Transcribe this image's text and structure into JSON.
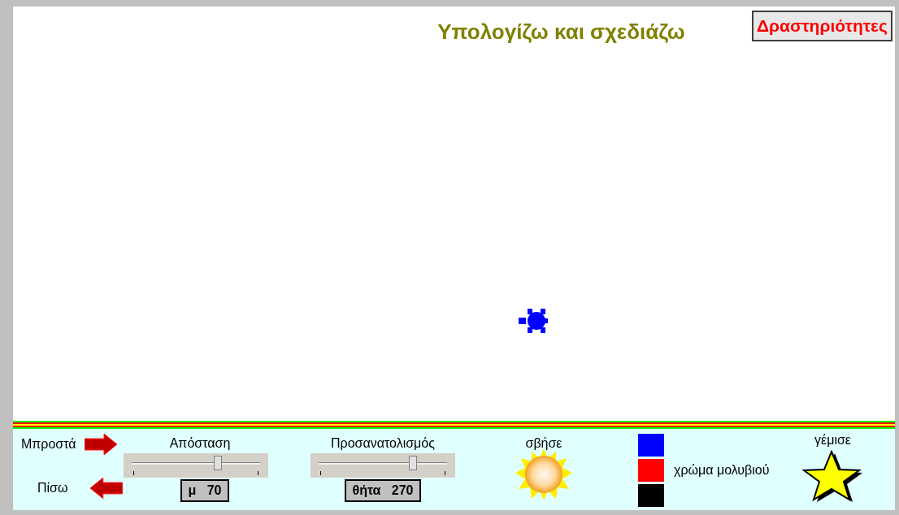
{
  "title": "Υπολογίζω και σχεδιάζω",
  "activities_button": "Δραστηριότητες",
  "forward": {
    "label": "Μπροστά"
  },
  "back": {
    "label": "Πίσω"
  },
  "distance": {
    "label": "Απόσταση",
    "level": 0.68,
    "reading": "μ   70"
  },
  "heading": {
    "label": "Προσανατολισμός",
    "level": 0.75,
    "reading": "θήτα   270"
  },
  "erase": {
    "label": "σβήσε"
  },
  "pen_colors": {
    "label": "χρώμα μολυβιού",
    "swatches": [
      {
        "color": "#0000ff"
      },
      {
        "color": "#ff0000"
      },
      {
        "color": "#000000"
      }
    ]
  },
  "fill": {
    "label": "γέμισε"
  }
}
